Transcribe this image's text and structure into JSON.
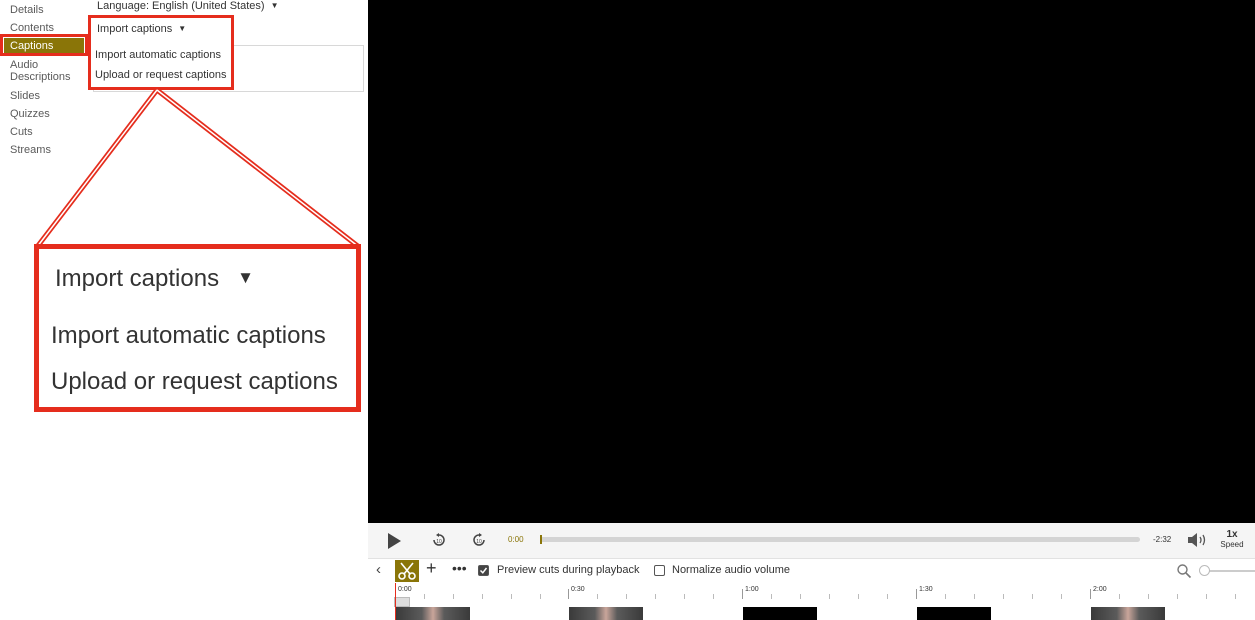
{
  "sidebar": {
    "items": [
      {
        "label": "Details"
      },
      {
        "label": "Contents"
      },
      {
        "label": "Captions"
      },
      {
        "label": "Audio"
      },
      {
        "label": "Descriptions"
      },
      {
        "label": "Slides"
      },
      {
        "label": "Quizzes"
      },
      {
        "label": "Cuts"
      },
      {
        "label": "Streams"
      }
    ]
  },
  "language": {
    "label": "Language: English (United States)"
  },
  "import_dropdown": {
    "button_label": "Import captions",
    "options": [
      {
        "label": "Import automatic captions"
      },
      {
        "label": "Upload or request captions"
      }
    ]
  },
  "player": {
    "current_time": "0:00",
    "remaining_time": "-2:32",
    "skip_back_seconds": "10",
    "skip_forward_seconds": "10",
    "speed_value": "1x",
    "speed_label": "Speed",
    "progress": 0.0
  },
  "toolbar": {
    "preview_cuts_label": "Preview cuts during playback",
    "preview_cuts_checked": true,
    "normalize_label": "Normalize audio volume",
    "normalize_checked": false
  },
  "timeline": {
    "labels": [
      "0:00",
      "0:30",
      "1:00",
      "1:30",
      "2:00"
    ]
  },
  "colors": {
    "accent": "#8a7508",
    "highlight": "#e52d1d",
    "video_bg": "#000000"
  }
}
